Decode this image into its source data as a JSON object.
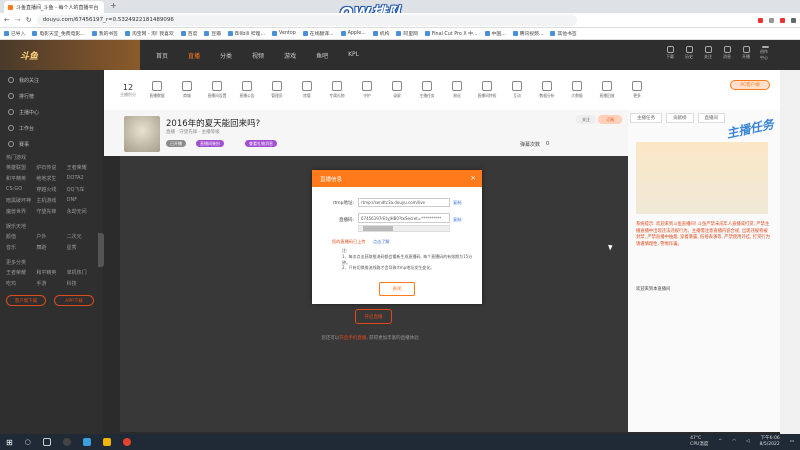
{
  "browser": {
    "tab_title": "斗鱼直播间_斗鱼 - 每个人的直播平台",
    "url": "douyu.com/67456197_r=0.5324922181489096",
    "bookmarks": [
      "已导入",
      "电影天堂_免费电影...",
      "我的书签",
      "淘宝网 - 淘! 我喜欢",
      "百度",
      "豆瓣",
      "Bilibili 哔哩...",
      "Ventop",
      "在线翻译...",
      "Apple...",
      "机构",
      "阿里网",
      "Final Cut Pro X 中...",
      "中国...",
      "腾讯视频...",
      "其他书签"
    ]
  },
  "overlay_logo": "OW排队",
  "site": {
    "brand": "斗鱼",
    "nav": [
      "首页",
      "直播",
      "分类",
      "视频",
      "游戏",
      "鱼吧",
      "KPL"
    ],
    "active_nav_index": 1,
    "header_icons": [
      "下载",
      "历史",
      "关注",
      "消息",
      "开播",
      "创作中心"
    ]
  },
  "sidebar": {
    "top_items": [
      "我的关注",
      "排行榜",
      "主播中心",
      "工作台",
      "赛事"
    ],
    "section1_header": "热门游戏",
    "section1_items": [
      "英雄联盟",
      "炉石传说",
      "王者荣耀",
      "和平精英",
      "绝地求生",
      "DOTA2",
      "CS:GO",
      "穿越火线",
      "QQ飞车",
      "暗黑破坏神",
      "主机游戏",
      "DNF",
      "魔兽世界",
      "守望先锋",
      "永劫无间"
    ],
    "section2_header": "娱乐天地",
    "section2_items": [
      "颜值",
      "户外",
      "二次元",
      "音乐",
      "舞蹈",
      "星秀"
    ],
    "section3_header": "更多分类",
    "section3_items": [
      "王者荣耀",
      "和平精英",
      "单机热门",
      "吃鸡",
      "手游",
      "科技"
    ],
    "buttons": [
      "客户端下载",
      "APP下载"
    ]
  },
  "tools": {
    "count_value": "12",
    "count_label": "主播积分",
    "items": [
      "直播数据",
      "商城",
      "直播间设置",
      "直播公告",
      "管理员",
      "房管",
      "专属礼物",
      "守护",
      "录屏",
      "主播任务",
      "粉丝",
      "直播间特权",
      "互动",
      "数据分析",
      "大数据",
      "直播回放",
      "更多"
    ],
    "pc_button": "PC客户端"
  },
  "room": {
    "title": "2016年的夏天能回来吗?",
    "meta": "直播 · 守望先锋 · 主播等级",
    "tag1": "已开播",
    "tag2": "直播间装扮",
    "tag3": "查看礼物消息",
    "follow": "关注",
    "follow2": "订阅",
    "play_count_label": "弹幕次数",
    "play_count_value": "0"
  },
  "player": {
    "open_live": "开启直播",
    "hint_prefix": "您还可以",
    "hint_link": "开启手机直播",
    "hint_suffix": ", 获得更加丰富的直播体验"
  },
  "modal": {
    "title": "直播信息",
    "close_glyph": "×",
    "rtmp_label": "rtmp地址:",
    "rtmp_value": "rtmp://sendtc3a.douyu.com/live",
    "code_label": "直播码:",
    "code_value": "67456197rEtyJHB0?txSecret=**********",
    "copy_label": "复制",
    "tip": "您的直播码已上传",
    "tip_link": "点击了解",
    "notes_title": "注:",
    "notes": [
      "1、每次点击获取推流码都会重新生成直播码, 每个直播码的有效期为15分钟。",
      "2、只有切换推流线路才会导致rtmp地址发生变化。"
    ],
    "close_button": "关闭"
  },
  "right_panel": {
    "tabs": [
      "主播任务",
      "贡献榜",
      "直播间"
    ],
    "banner_text": "主播任务",
    "chat1": "系统提示: 欢迎来到斗鱼直播间! 斗鱼严禁未成年人直播或打赏, 严禁主播直播中出现违法违规行为。主播需注意直播内容合规, 出现违规将被封禁, 严禁直播中抽烟, 穿着暴露, 低俗表演等, 严禁使用外挂, 打赏行为请谨慎理性, 警惕诈骗。",
    "chat2": "欢迎来到本直播间"
  },
  "taskbar": {
    "weather": "47°C",
    "weather_label": "CPU温度",
    "time": "下午6:06",
    "date": "8/5/2022"
  }
}
